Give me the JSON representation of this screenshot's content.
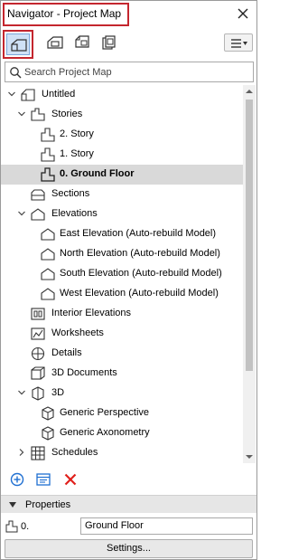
{
  "window": {
    "title": "Navigator - Project Map"
  },
  "toolbar": {
    "items": [
      {
        "icon": "project-map-icon",
        "active": true
      },
      {
        "icon": "view-map-icon",
        "active": false
      },
      {
        "icon": "layout-book-icon",
        "active": false
      },
      {
        "icon": "publisher-sets-icon",
        "active": false
      }
    ],
    "menu_icon": "hamburger-menu-icon"
  },
  "search": {
    "placeholder": "Search Project Map",
    "value": ""
  },
  "tree": {
    "items": [
      {
        "label": "Untitled",
        "indent": 0,
        "expander": "open",
        "icon": "project-icon"
      },
      {
        "label": "Stories",
        "indent": 1,
        "expander": "open",
        "icon": "stories-icon"
      },
      {
        "label": "2. Story",
        "indent": 2,
        "expander": "none",
        "icon": "story-icon"
      },
      {
        "label": "1. Story",
        "indent": 2,
        "expander": "none",
        "icon": "story-icon"
      },
      {
        "label": "0. Ground Floor",
        "indent": 2,
        "expander": "none",
        "icon": "story-icon",
        "selected": true
      },
      {
        "label": "Sections",
        "indent": 1,
        "expander": "none",
        "icon": "section-icon"
      },
      {
        "label": "Elevations",
        "indent": 1,
        "expander": "open",
        "icon": "elevation-icon"
      },
      {
        "label": "East Elevation (Auto-rebuild Model)",
        "indent": 2,
        "expander": "none",
        "icon": "elevation-view-icon"
      },
      {
        "label": "North Elevation (Auto-rebuild Model)",
        "indent": 2,
        "expander": "none",
        "icon": "elevation-view-icon"
      },
      {
        "label": "South Elevation (Auto-rebuild Model)",
        "indent": 2,
        "expander": "none",
        "icon": "elevation-view-icon"
      },
      {
        "label": "West Elevation (Auto-rebuild Model)",
        "indent": 2,
        "expander": "none",
        "icon": "elevation-view-icon"
      },
      {
        "label": "Interior Elevations",
        "indent": 1,
        "expander": "none",
        "icon": "interior-elevation-icon"
      },
      {
        "label": "Worksheets",
        "indent": 1,
        "expander": "none",
        "icon": "worksheet-icon"
      },
      {
        "label": "Details",
        "indent": 1,
        "expander": "none",
        "icon": "detail-icon"
      },
      {
        "label": "3D Documents",
        "indent": 1,
        "expander": "none",
        "icon": "3d-document-icon"
      },
      {
        "label": "3D",
        "indent": 1,
        "expander": "open",
        "icon": "3d-icon"
      },
      {
        "label": "Generic Perspective",
        "indent": 2,
        "expander": "none",
        "icon": "perspective-icon"
      },
      {
        "label": "Generic Axonometry",
        "indent": 2,
        "expander": "none",
        "icon": "axonometry-icon"
      },
      {
        "label": "Schedules",
        "indent": 1,
        "expander": "closed",
        "icon": "schedule-icon"
      }
    ]
  },
  "bottom_actions": [
    {
      "icon": "new-viewpoint-icon"
    },
    {
      "icon": "properties-icon"
    },
    {
      "icon": "delete-icon"
    }
  ],
  "properties": {
    "header": "Properties",
    "story_number": "0.",
    "story_name": "Ground Floor",
    "settings_label": "Settings..."
  },
  "colors": {
    "highlight_border": "#c4262e",
    "active_tool_bg": "#cfe1f6",
    "selection_bg": "#d9d9d9",
    "accent_blue": "#1f6fd1",
    "delete_red": "#e0201b"
  }
}
